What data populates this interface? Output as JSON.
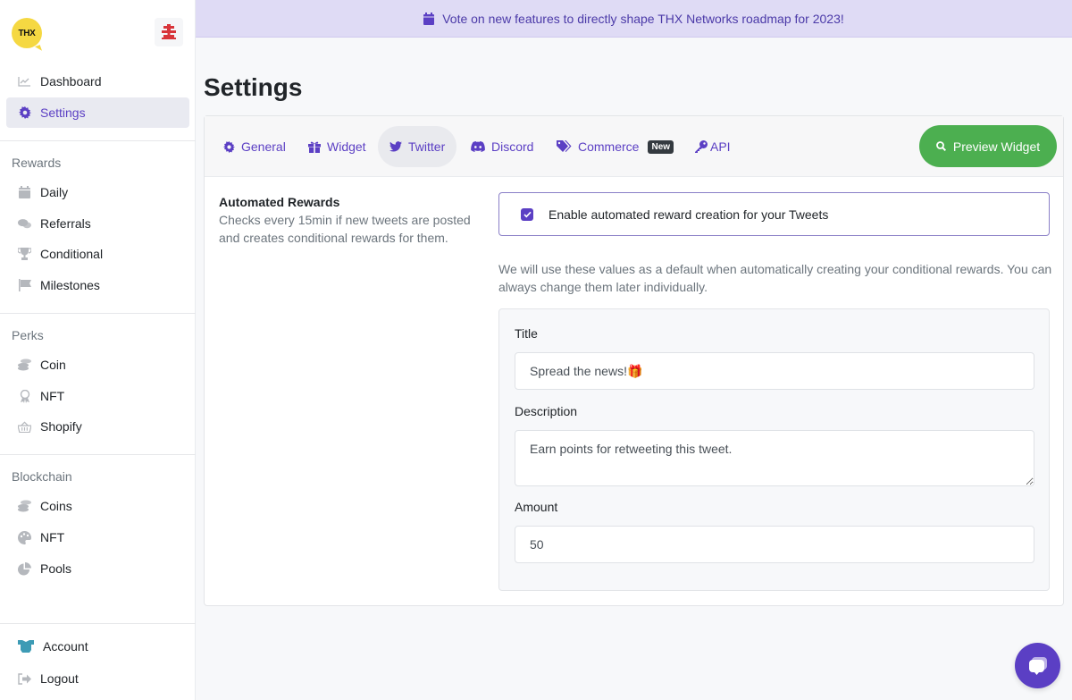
{
  "sidebar": {
    "logo_text": "THX",
    "top_items": [
      {
        "label": "Dashboard",
        "icon": "chart-line-icon",
        "active": false
      },
      {
        "label": "Settings",
        "icon": "gear-icon",
        "active": true
      }
    ],
    "sections": [
      {
        "title": "Rewards",
        "items": [
          {
            "label": "Daily",
            "icon": "calendar-icon"
          },
          {
            "label": "Referrals",
            "icon": "comments-icon"
          },
          {
            "label": "Conditional",
            "icon": "trophy-icon"
          },
          {
            "label": "Milestones",
            "icon": "flag-icon"
          }
        ]
      },
      {
        "title": "Perks",
        "items": [
          {
            "label": "Coin",
            "icon": "coins-icon"
          },
          {
            "label": "NFT",
            "icon": "award-icon"
          },
          {
            "label": "Shopify",
            "icon": "basket-icon"
          }
        ]
      },
      {
        "title": "Blockchain",
        "items": [
          {
            "label": "Coins",
            "icon": "coins-icon"
          },
          {
            "label": "NFT",
            "icon": "palette-icon"
          },
          {
            "label": "Pools",
            "icon": "pie-chart-icon"
          }
        ]
      }
    ],
    "bottom_items": [
      {
        "label": "Account",
        "icon": "account-avatar-icon"
      },
      {
        "label": "Logout",
        "icon": "logout-icon"
      }
    ]
  },
  "banner": {
    "text": "Vote on new features to directly shape THX Networks roadmap for 2023!",
    "icon": "calendar-icon"
  },
  "page": {
    "title": "Settings"
  },
  "tabs": [
    {
      "label": "General",
      "icon": "gear-icon",
      "active": false
    },
    {
      "label": "Widget",
      "icon": "gift-icon",
      "active": false
    },
    {
      "label": "Twitter",
      "icon": "twitter-icon",
      "active": true
    },
    {
      "label": "Discord",
      "icon": "discord-icon",
      "active": false
    },
    {
      "label": "Commerce",
      "icon": "tags-icon",
      "active": false,
      "badge": "New"
    },
    {
      "label": "API",
      "icon": "key-icon",
      "active": false
    }
  ],
  "preview_button": {
    "label": "Preview Widget",
    "icon": "search-icon"
  },
  "automated_rewards": {
    "title": "Automated Rewards",
    "description": "Checks every 15min if new tweets are posted and creates conditional rewards for them.",
    "enable_label": "Enable automated reward creation for your Tweets",
    "enabled": true,
    "defaults_note": "We will use these values as a default when automatically creating your conditional rewards. You can always change them later individually."
  },
  "form": {
    "title_label": "Title",
    "title_value": "Spread the news!🎁",
    "description_label": "Description",
    "description_value": "Earn points for retweeting this tweet.",
    "amount_label": "Amount",
    "amount_value": "50"
  },
  "colors": {
    "accent": "#5b3fc4",
    "success": "#4caf50",
    "banner_bg": "#dfdbf5",
    "logo_yellow": "#f5d842"
  }
}
